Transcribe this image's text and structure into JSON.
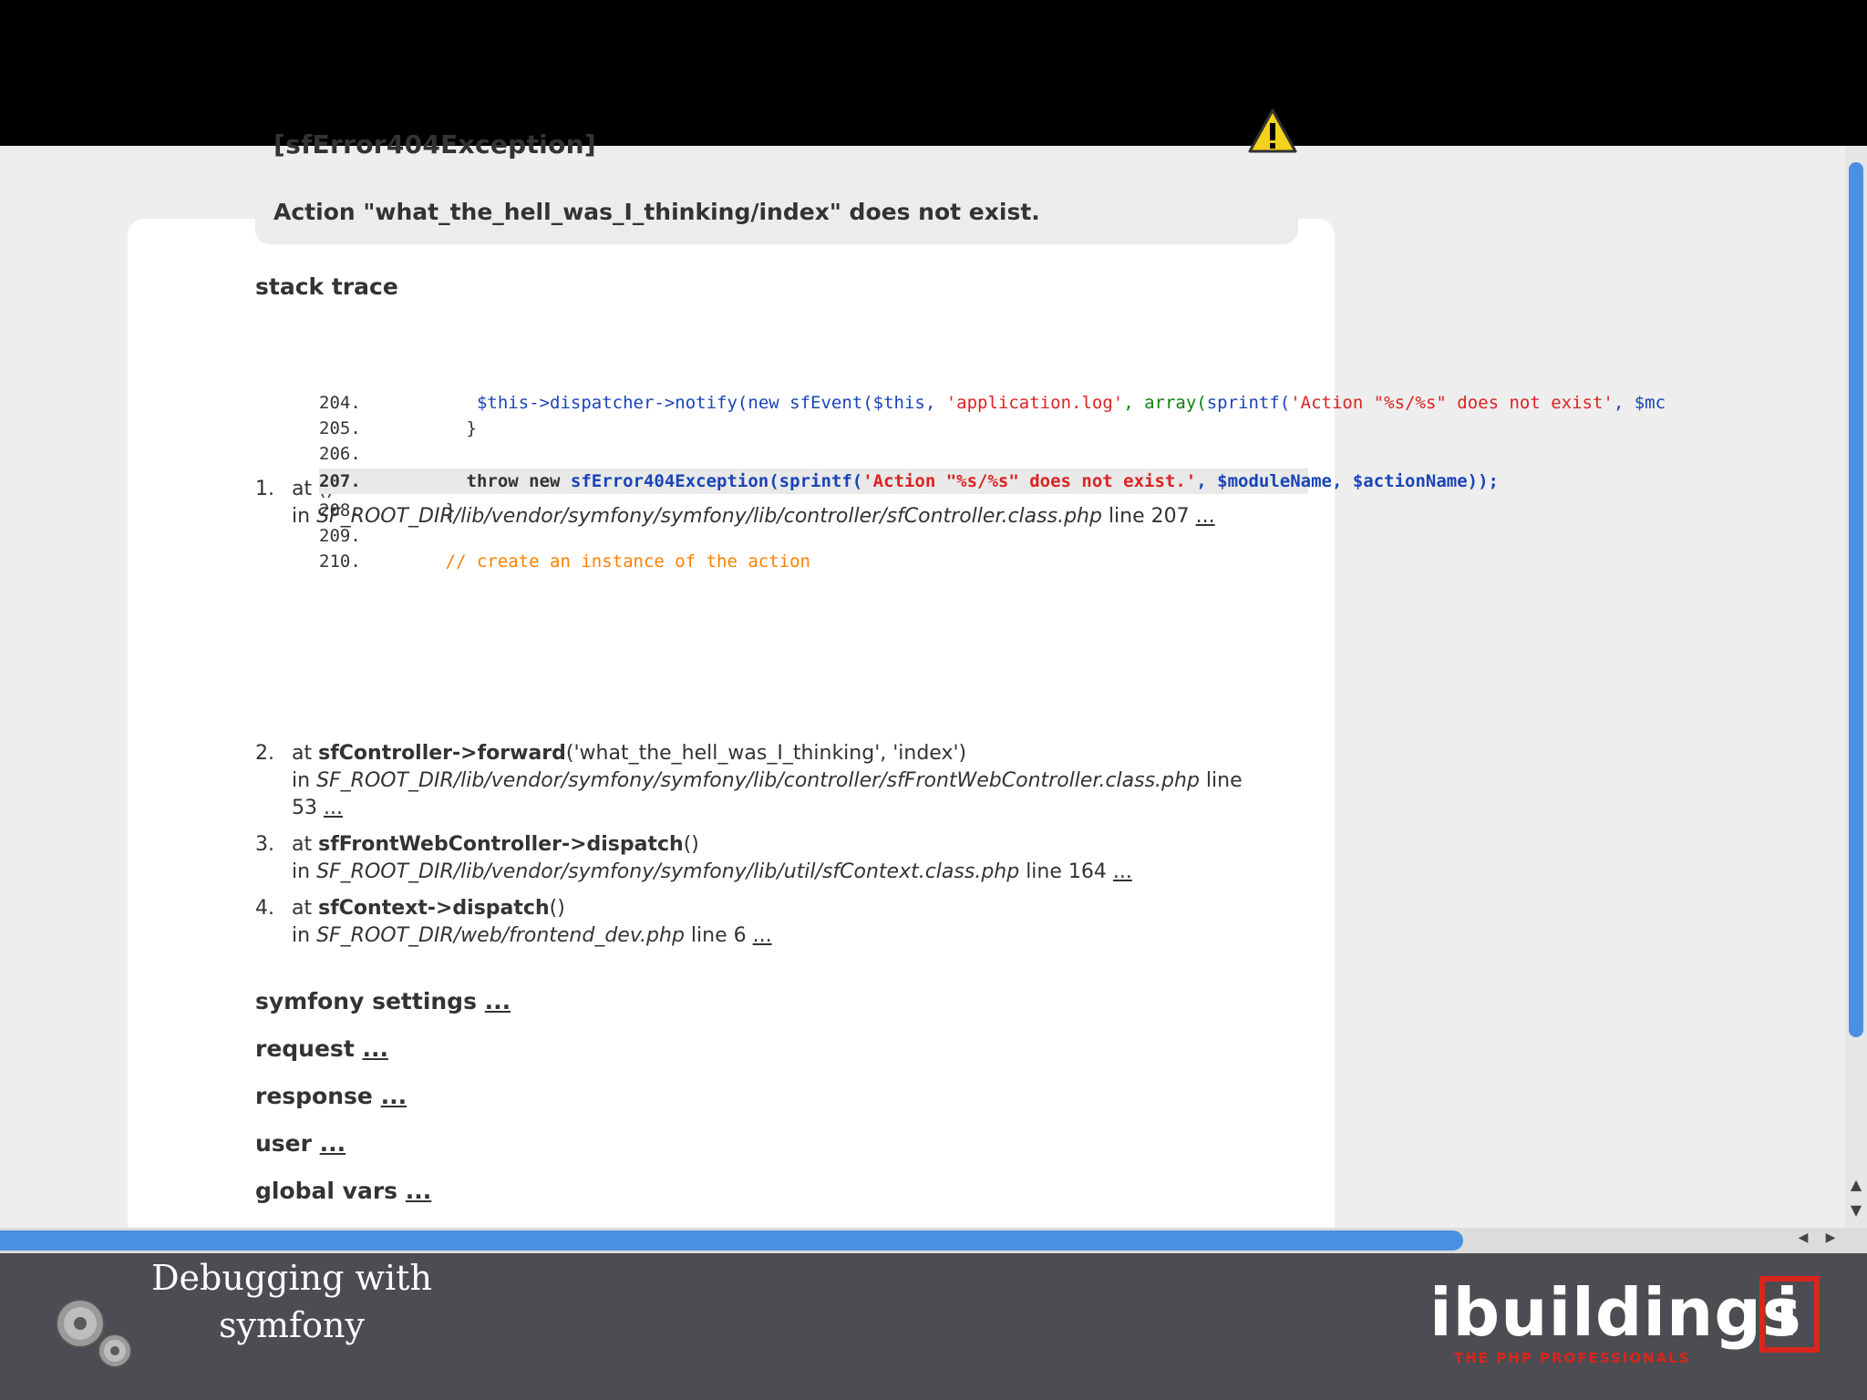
{
  "error": {
    "title": "[sfError404Exception]",
    "message": "Action \"what_the_hell_was_I_thinking/index\" does not exist."
  },
  "stack_trace_title": "stack trace",
  "trace": [
    {
      "num": "1.",
      "at": "at ()",
      "path": "SF_ROOT_DIR/lib/vendor/symfony/symfony/lib/controller/sfController.class.php",
      "line": " line 207 ",
      "more": "..."
    },
    {
      "num": "2.",
      "at_prefix": "at ",
      "call": "sfController->forward",
      "args": "('what_the_hell_was_I_thinking', 'index')",
      "path": "SF_ROOT_DIR/lib/vendor/symfony/symfony/lib/controller/sfFrontWebController.class.php",
      "line": " line",
      "line2": "53 ",
      "more": "..."
    },
    {
      "num": "3.",
      "at_prefix": "at ",
      "call": "sfFrontWebController->dispatch",
      "args": "()",
      "path": "SF_ROOT_DIR/lib/vendor/symfony/symfony/lib/util/sfContext.class.php",
      "line": " line 164 ",
      "more": "..."
    },
    {
      "num": "4.",
      "at_prefix": "at ",
      "call": "sfContext->dispatch",
      "args": "()",
      "path": "SF_ROOT_DIR/web/frontend_dev.php",
      "line": " line 6 ",
      "more": "..."
    }
  ],
  "code": {
    "l204": "204.",
    "l204_a": "         $this->dispatcher->notify(",
    "l204_b": "new sfEvent(",
    "l204_c": "$this, ",
    "l204_d": "'application.log'",
    "l204_e": ", array(",
    "l204_f": "sprintf(",
    "l204_g": "'Action \"%s/%s\" does not exist'",
    "l204_h": ", $mc",
    "l205": "205.",
    "l205_t": "        }",
    "l206": "206.",
    "l207": "207.",
    "l207_a": "        throw new ",
    "l207_b": "sfError404Exception(sprintf(",
    "l207_c": "'Action \"%s/%s\" does not exist.'",
    "l207_d": ", $moduleName, $actionName));",
    "l208": "208.",
    "l208_t": "      }",
    "l209": "209.",
    "l210": "210.",
    "l210_t": "      // create an instance of the action"
  },
  "sections": [
    {
      "label": "symfony settings ",
      "more": "..."
    },
    {
      "label": "request ",
      "more": "..."
    },
    {
      "label": "response ",
      "more": "..."
    },
    {
      "label": "user ",
      "more": "..."
    },
    {
      "label": "global vars ",
      "more": "..."
    }
  ],
  "footer": {
    "title_line1": "Debugging with",
    "title_line2": "symfony",
    "brand": "ibuildings",
    "brand_i": "i",
    "tagline": "THE PHP PROFESSIONALS"
  },
  "colors": {
    "accent": "#4a90e2",
    "brand_red": "#d9261c",
    "code_blue": "#1a44b8",
    "code_red": "#dd2222",
    "code_comment": "#ff8000"
  },
  "icons": [
    "warning-icon",
    "gears-icon",
    "scroll-up-icon",
    "scroll-down-icon",
    "scroll-left-icon",
    "scroll-right-icon"
  ]
}
